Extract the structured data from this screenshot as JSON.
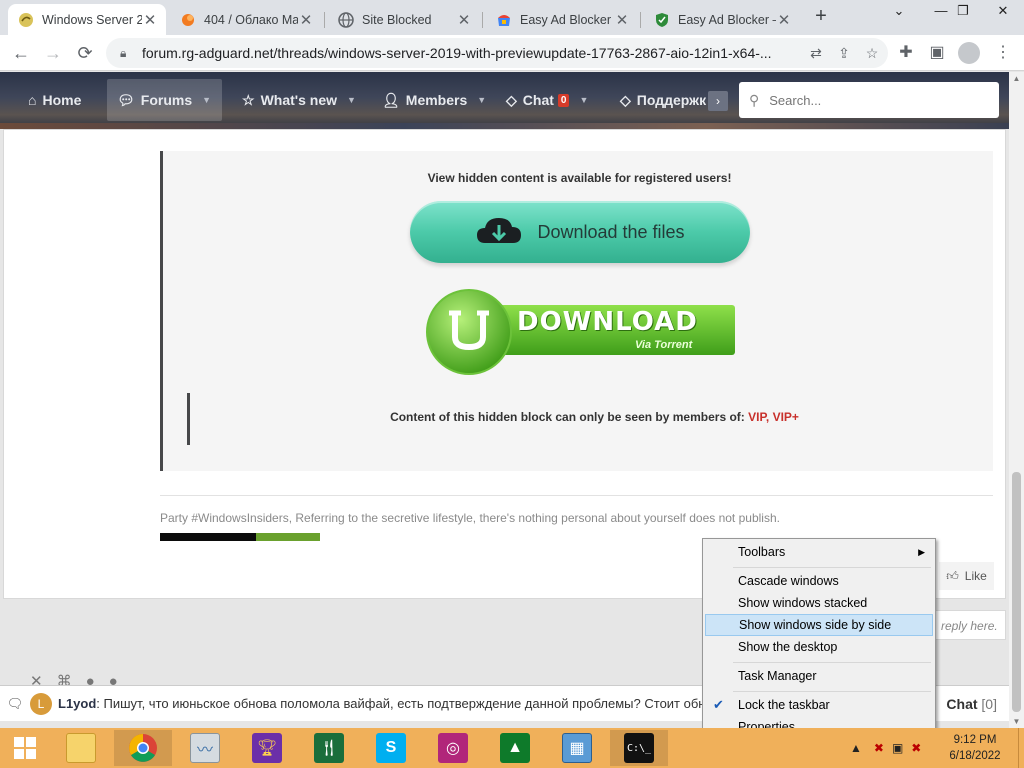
{
  "tabs": [
    {
      "title": "Windows Server 2",
      "active": true
    },
    {
      "title": "404 / Облако Ma"
    },
    {
      "title": "Site Blocked"
    },
    {
      "title": "Easy Ad Blocker –"
    },
    {
      "title": "Easy Ad Blocker –"
    }
  ],
  "toolbar": {
    "url": "forum.rg-adguard.net/threads/windows-server-2019-with-previewupdate-17763-2867-aio-12in1-x64-..."
  },
  "forum_nav": {
    "items": [
      {
        "label": "Home"
      },
      {
        "label": "Forums"
      },
      {
        "label": "What's new"
      },
      {
        "label": "Members"
      },
      {
        "label": "Chat",
        "badge": "0"
      },
      {
        "label": "Поддержк"
      }
    ],
    "search_placeholder": "Search..."
  },
  "post": {
    "hidden_note": "View hidden content is available for registered users!",
    "download_button": "Download the files",
    "torrent_title": "DOWNLOAD",
    "torrent_sub": "Via Torrent",
    "vip_text": "Content of this hidden block can only be seen by members of:",
    "vip_groups": "VIP, VIP+",
    "signature": "Party #WindowsInsiders, Referring to the secretive lifestyle, there's nothing personal about yourself does not publish.",
    "like_label": "Like"
  },
  "reply_hint": "reply here.",
  "chat": {
    "avatar_letter": "L",
    "user": "L1yod",
    "message": ": Пишут, что июньское обнова поломола вайфай, есть подтверждение данной проблемы? Стоит обновляться?",
    "label": "Chat",
    "count": "[0]"
  },
  "context_menu": {
    "items": [
      {
        "label": "Toolbars",
        "submenu": true
      },
      {
        "label": "Cascade windows"
      },
      {
        "label": "Show windows stacked"
      },
      {
        "label": "Show windows side by side",
        "highlighted": true
      },
      {
        "label": "Show the desktop"
      },
      {
        "label": "Task Manager"
      },
      {
        "label": "Lock the taskbar",
        "checked": true
      },
      {
        "label": "Properties"
      }
    ]
  },
  "taskbar": {
    "apps": [
      "file-explorer",
      "chrome",
      "system-monitor",
      "trophy",
      "kitchen-timer",
      "skype",
      "camera",
      "stock-chart",
      "control-panel",
      "command-prompt"
    ],
    "time": "9:12 PM",
    "date": "6/18/2022",
    "color": "#f0b05a"
  },
  "colors": {
    "accent_green": "#4ccaa9",
    "vip_red": "#c8302b",
    "menu_highlight": "#cce4f7"
  }
}
